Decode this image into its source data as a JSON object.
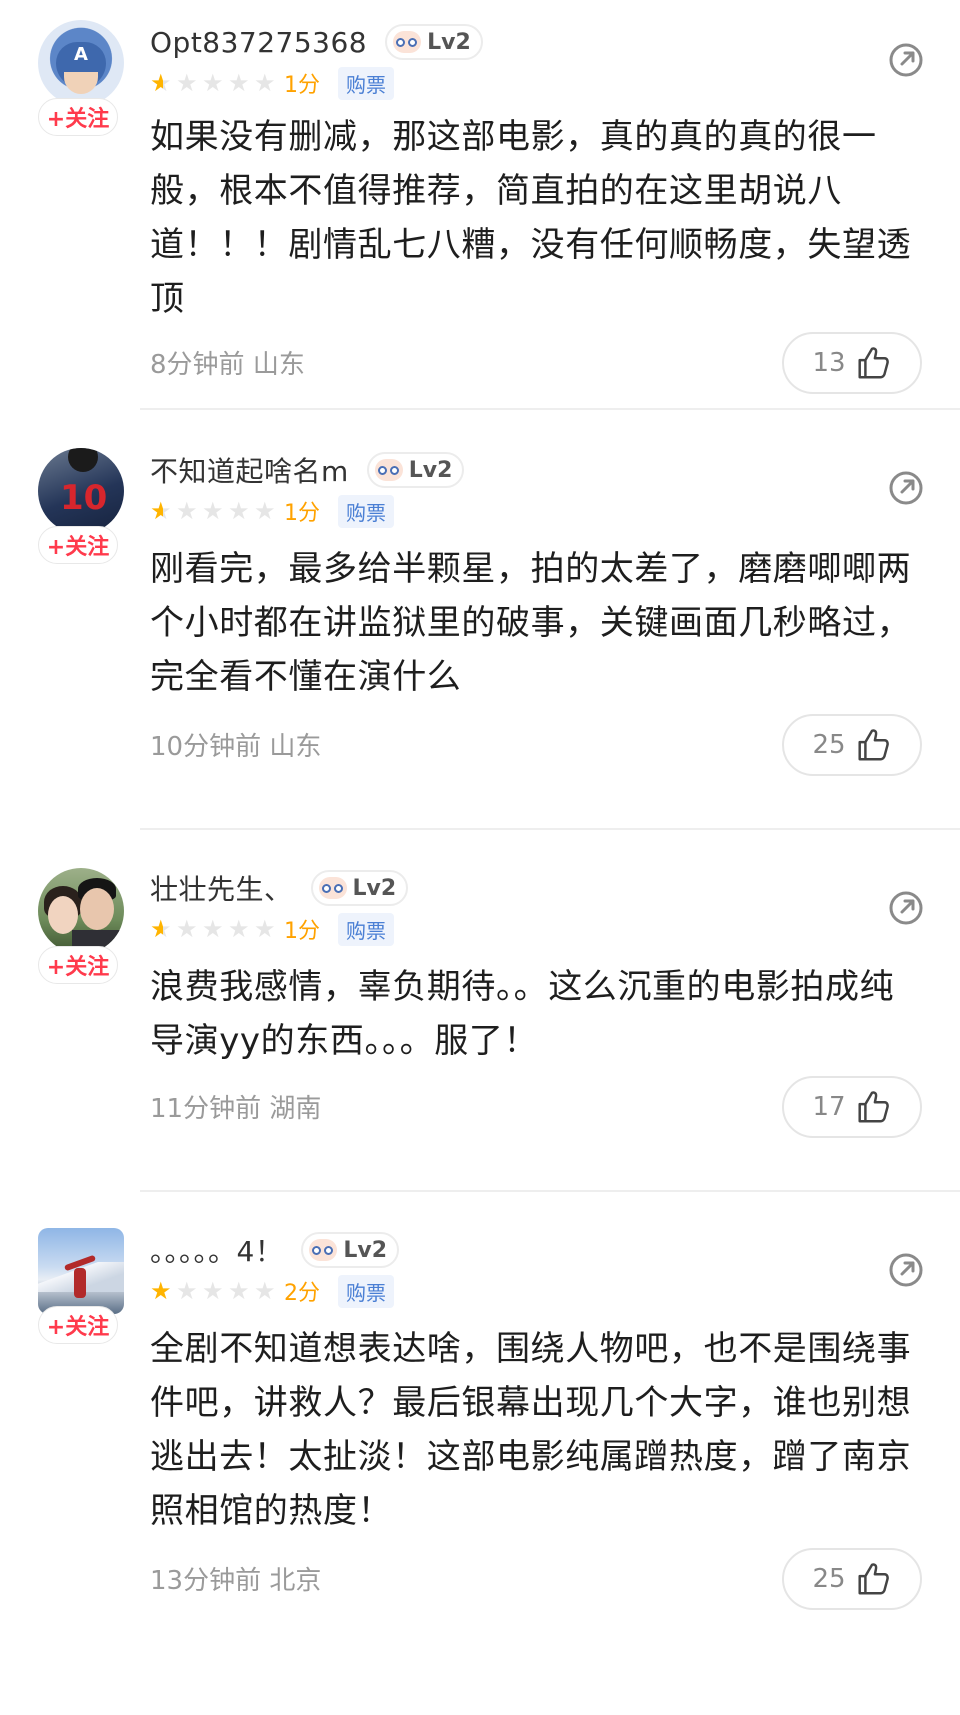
{
  "labels": {
    "follow": "+关注",
    "purchase_tag": "购票"
  },
  "colors": {
    "star": "#ffb400",
    "score": "#ffa200",
    "follow": "#ff3a4c",
    "tag_text": "#4a7fd4"
  },
  "comments": [
    {
      "username": "Opt837275368",
      "level": "Lv2",
      "stars": 0.5,
      "score": "1分",
      "text": "如果没有删减，那这部电影，真的真的真的很一般，根本不值得推荐，简直拍的在这里胡说八道！！！剧情乱七八糟，没有任何顺畅度，失望透顶",
      "time": "8分钟前",
      "location": "山东",
      "likes": "13",
      "avatar_icon": "captain-america-avatar"
    },
    {
      "username": "不知道起啥名m",
      "level": "Lv2",
      "stars": 0.5,
      "score": "1分",
      "text": "刚看完，最多给半颗星，拍的太差了，磨磨唧唧两个小时都在讲监狱里的破事，关键画面几秒略过，完全看不懂在演什么",
      "time": "10分钟前",
      "location": "山东",
      "likes": "25",
      "avatar_icon": "jersey-avatar"
    },
    {
      "username": "壮壮先生、",
      "level": "Lv2",
      "stars": 0.5,
      "score": "1分",
      "text": "浪费我感情，辜负期待。。这么沉重的电影拍成纯导演yy的东西。。。服了！",
      "time": "11分钟前",
      "location": "湖南",
      "likes": "17",
      "avatar_icon": "couple-photo-avatar"
    },
    {
      "username": "。。。。。4！",
      "level": "Lv2",
      "stars": 1,
      "score": "2分",
      "text": "全剧不知道想表达啥，围绕人物吧，也不是围绕事件吧，讲救人？最后银幕出现几个大字，谁也别想逃出去！太扯淡！这部电影纯属蹭热度，蹭了南京照相馆的热度！",
      "time": "13分钟前",
      "location": "北京",
      "likes": "25",
      "avatar_icon": "snow-mountain-avatar"
    }
  ]
}
